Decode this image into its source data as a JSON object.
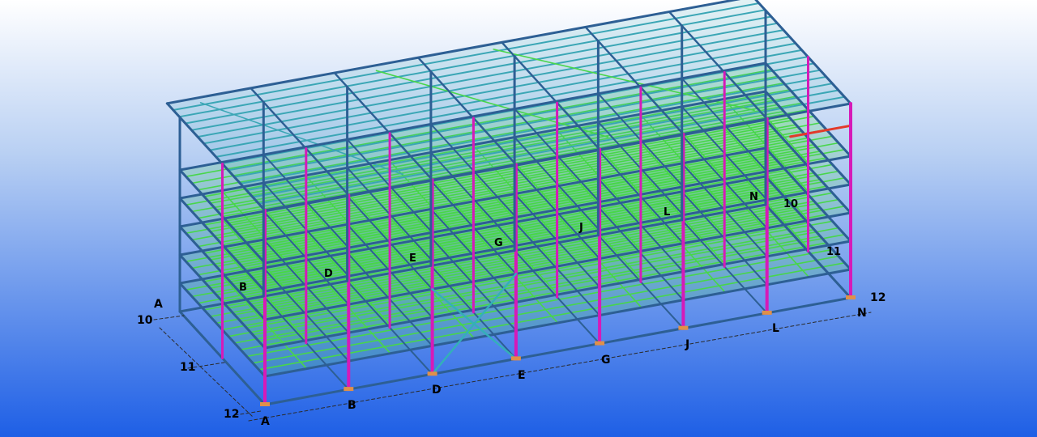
{
  "colors": {
    "sky_top": "#ffffff",
    "sky_bottom": "#1e5fe6",
    "column": "#d61ab8",
    "beam": "#2d5f94",
    "joist": "#48d64a",
    "deck": "#3aa6b5",
    "roof_edge": "#3b6ba0",
    "brace": "#33b0b8",
    "highlight": "#e23a2a",
    "plate": "#e0904a",
    "grid_line": "#2a2a2a"
  },
  "grid_axes": {
    "front_lines": [
      "A",
      "B",
      "D",
      "E",
      "G",
      "J",
      "L",
      "N"
    ],
    "side_lines": [
      "10",
      "11",
      "12"
    ]
  },
  "labels": {
    "front_A": "A",
    "front_B": "B",
    "front_D": "D",
    "front_E": "E",
    "front_G": "G",
    "front_J": "J",
    "front_L": "L",
    "front_N": "N",
    "side_10_left": "10",
    "side_11_left": "11",
    "side_12_left": "12",
    "side_A_left": "A",
    "side_12_right": "12",
    "inner_B": "B",
    "inner_D": "D",
    "inner_E": "E",
    "inner_G": "G",
    "inner_J": "J",
    "inner_L": "L",
    "inner_N": "N",
    "inner_10": "10",
    "inner_11": "11"
  }
}
